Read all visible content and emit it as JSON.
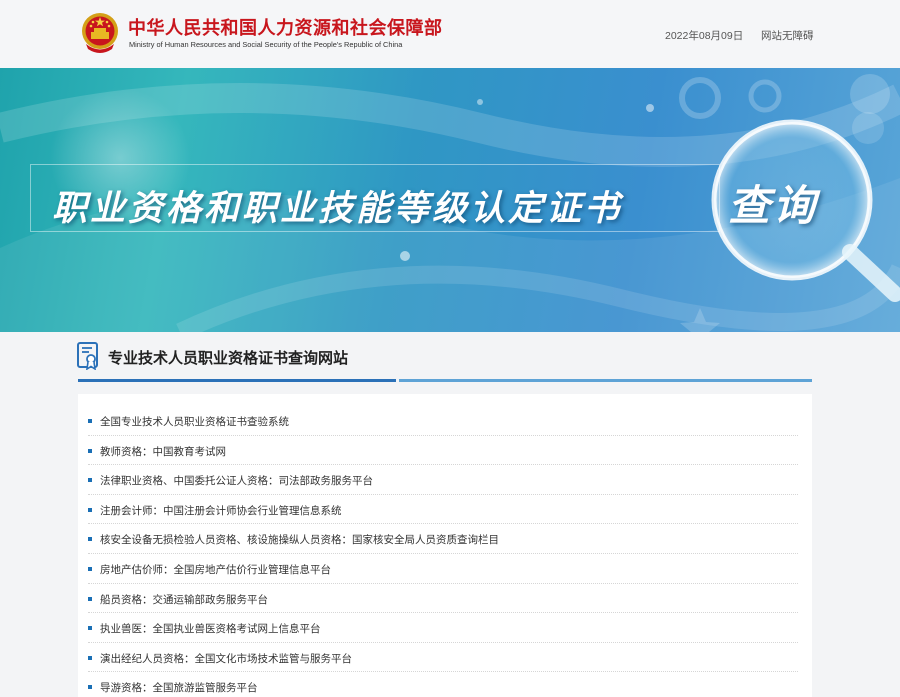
{
  "header": {
    "ministry_name_cn": "中华人民共和国人力资源和社会保障部",
    "ministry_name_en": "Ministry of Human Resources and Social Security of the People's Republic of China",
    "date": "2022年08月09日",
    "accessibility_link": "网站无障碍",
    "emblem_icon": "national-emblem-icon"
  },
  "banner": {
    "title": "职业资格和职业技能等级认定证书",
    "query_text": "查询"
  },
  "section": {
    "icon": "certificate-icon",
    "title": "专业技术人员职业资格证书查询网站"
  },
  "colors": {
    "brand_red": "#c8161d",
    "accent_blue": "#2b71b8",
    "bullet_blue": "#1a6fb5"
  },
  "links": [
    "全国专业技术人员职业资格证书查验系统",
    "教师资格：中国教育考试网",
    "法律职业资格、中国委托公证人资格：司法部政务服务平台",
    "注册会计师：中国注册会计师协会行业管理信息系统",
    "核安全设备无损检验人员资格、核设施操纵人员资格：国家核安全局人员资质查询栏目",
    "房地产估价师：全国房地产估价行业管理信息平台",
    "船员资格：交通运输部政务服务平台",
    "执业兽医：全国执业兽医资格考试网上信息平台",
    "演出经纪人员资格：全国文化市场技术监管与服务平台",
    "导游资格：全国旅游监管服务平台"
  ]
}
